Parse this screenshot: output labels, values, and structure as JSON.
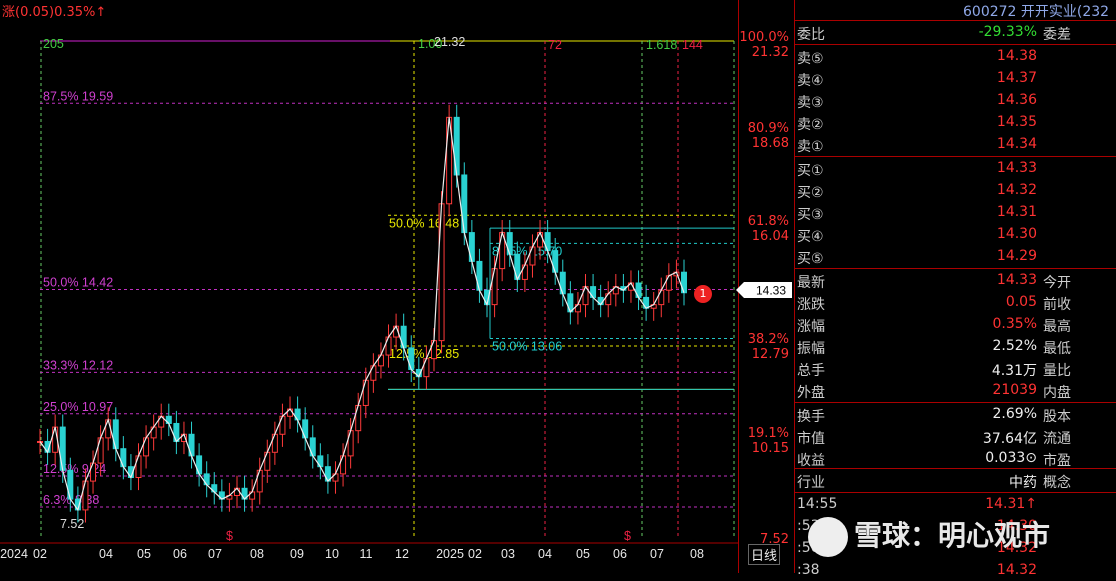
{
  "header": {
    "change_info": "涨(0.05)0.35%↑"
  },
  "chart_data": {
    "type": "candlestick",
    "ylim": [
      7.52,
      21.32
    ],
    "x_ticks": [
      "2024",
      "02",
      "04",
      "05",
      "06",
      "07",
      "08",
      "09",
      "10",
      "11",
      "12",
      "2025",
      "02",
      "03",
      "04",
      "05",
      "06",
      "07",
      "08"
    ],
    "close_series": [
      10.2,
      9.9,
      10.6,
      9.4,
      8.6,
      8.3,
      9.1,
      9.6,
      10.3,
      10.8,
      10.0,
      9.5,
      9.2,
      9.8,
      10.3,
      10.6,
      10.9,
      10.7,
      10.2,
      10.4,
      9.8,
      9.3,
      9.0,
      8.8,
      8.6,
      8.7,
      8.9,
      8.6,
      8.8,
      9.4,
      9.9,
      10.4,
      10.9,
      11.1,
      10.8,
      10.3,
      9.8,
      9.5,
      9.1,
      9.3,
      9.8,
      10.5,
      11.2,
      11.9,
      12.3,
      12.6,
      13.1,
      13.4,
      12.8,
      12.2,
      12.0,
      12.5,
      13.0,
      16.8,
      19.2,
      17.6,
      16.0,
      15.2,
      14.4,
      14.0,
      15.0,
      16.0,
      15.4,
      14.7,
      15.1,
      15.6,
      16.0,
      15.5,
      14.9,
      14.3,
      13.8,
      14.0,
      14.5,
      14.2,
      14.0,
      14.3,
      14.5,
      14.4,
      14.6,
      14.2,
      13.9,
      14.0,
      14.4,
      14.8,
      14.9,
      14.33
    ],
    "fib_left": {
      "label_205": "205",
      "levels": [
        {
          "pct": "87.5%",
          "value": "19.59"
        },
        {
          "pct": "50.0%",
          "value": "14.42"
        },
        {
          "pct": "33.3%",
          "value": "12.12"
        },
        {
          "pct": "25.0%",
          "value": "10.97"
        },
        {
          "pct": "12.5%",
          "value": "9.24"
        },
        {
          "pct": "6.3%",
          "value": "8.38"
        }
      ],
      "low": "7.52"
    },
    "fib_mid": {
      "levels": [
        {
          "pct": "50.0%",
          "value": "16.48"
        },
        {
          "pct": "12.5%",
          "value": "12.85"
        }
      ]
    },
    "fib_inner": {
      "levels": [
        {
          "pct": "87.5%",
          "value": "15.70"
        },
        {
          "pct": "50.0%",
          "value": "13.06"
        }
      ]
    },
    "top_marks": {
      "m1": "1.00",
      "peak": "21.32",
      "m2": "72",
      "m3": "1.618",
      "m4": "144"
    },
    "right_scale": [
      {
        "pct": "100.0%",
        "value": "21.32"
      },
      {
        "pct": "80.9%",
        "value": "18.68"
      },
      {
        "pct": "61.8%",
        "value": "16.04"
      },
      {
        "pct": "38.2%",
        "value": "12.79"
      },
      {
        "pct": "19.1%",
        "value": "10.15"
      },
      {
        "pct": "",
        "value": "7.52"
      }
    ],
    "last_price": "14.33",
    "badge": "1"
  },
  "panel": {
    "title": "600272 开开实业(232",
    "wb": {
      "label": "委比",
      "value": "-29.33%",
      "ext": "委差"
    },
    "asks": [
      {
        "label": "卖⑤",
        "value": "14.38"
      },
      {
        "label": "卖④",
        "value": "14.37"
      },
      {
        "label": "卖③",
        "value": "14.36"
      },
      {
        "label": "卖②",
        "value": "14.35"
      },
      {
        "label": "卖①",
        "value": "14.34"
      }
    ],
    "bids": [
      {
        "label": "买①",
        "value": "14.33"
      },
      {
        "label": "买②",
        "value": "14.32"
      },
      {
        "label": "买③",
        "value": "14.31"
      },
      {
        "label": "买④",
        "value": "14.30"
      },
      {
        "label": "买⑤",
        "value": "14.29"
      }
    ],
    "stats": [
      {
        "label": "最新",
        "value": "14.33",
        "ext": "今开",
        "color": "red"
      },
      {
        "label": "涨跌",
        "value": "0.05",
        "ext": "前收",
        "color": "red"
      },
      {
        "label": "涨幅",
        "value": "0.35%",
        "ext": "最高",
        "color": "red"
      },
      {
        "label": "振幅",
        "value": "2.52%",
        "ext": "最低",
        "color": "white"
      },
      {
        "label": "总手",
        "value": "4.31万",
        "ext": "量比",
        "color": "white"
      },
      {
        "label": "外盘",
        "value": "21039",
        "ext": "内盘",
        "color": "red"
      }
    ],
    "stats2": [
      {
        "label": "换手",
        "value": "2.69%",
        "ext": "股本",
        "color": "white"
      },
      {
        "label": "市值",
        "value": "37.64亿",
        "ext": "流通",
        "color": "white"
      },
      {
        "label": "收益",
        "value": "0.033⊙",
        "ext": "市盈",
        "color": "white"
      }
    ],
    "industry": {
      "label": "行业",
      "value": "中药",
      "ext": "概念"
    },
    "ticks": [
      {
        "time": "14:55",
        "price": "14.31↑"
      },
      {
        "time": ":53",
        "price": "14.30"
      },
      {
        "time": ":50",
        "price": "14.32"
      },
      {
        "time": ":38",
        "price": "14.32"
      }
    ]
  },
  "period": "日线",
  "watermark": "雪球：明心观市"
}
